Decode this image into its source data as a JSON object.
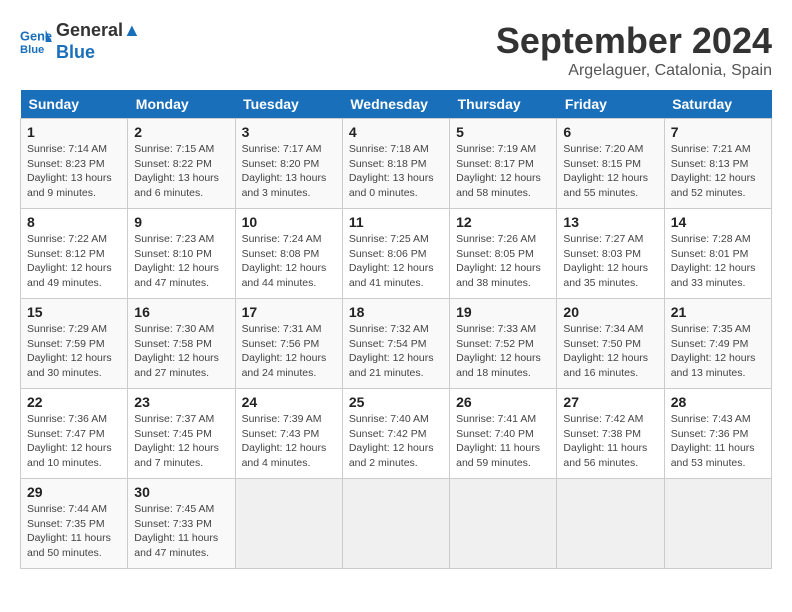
{
  "header": {
    "logo_line1": "General",
    "logo_line2": "Blue",
    "month": "September 2024",
    "location": "Argelaguer, Catalonia, Spain"
  },
  "weekdays": [
    "Sunday",
    "Monday",
    "Tuesday",
    "Wednesday",
    "Thursday",
    "Friday",
    "Saturday"
  ],
  "weeks": [
    [
      {
        "day": "1",
        "info": "Sunrise: 7:14 AM\nSunset: 8:23 PM\nDaylight: 13 hours\nand 9 minutes."
      },
      {
        "day": "2",
        "info": "Sunrise: 7:15 AM\nSunset: 8:22 PM\nDaylight: 13 hours\nand 6 minutes."
      },
      {
        "day": "3",
        "info": "Sunrise: 7:17 AM\nSunset: 8:20 PM\nDaylight: 13 hours\nand 3 minutes."
      },
      {
        "day": "4",
        "info": "Sunrise: 7:18 AM\nSunset: 8:18 PM\nDaylight: 13 hours\nand 0 minutes."
      },
      {
        "day": "5",
        "info": "Sunrise: 7:19 AM\nSunset: 8:17 PM\nDaylight: 12 hours\nand 58 minutes."
      },
      {
        "day": "6",
        "info": "Sunrise: 7:20 AM\nSunset: 8:15 PM\nDaylight: 12 hours\nand 55 minutes."
      },
      {
        "day": "7",
        "info": "Sunrise: 7:21 AM\nSunset: 8:13 PM\nDaylight: 12 hours\nand 52 minutes."
      }
    ],
    [
      {
        "day": "8",
        "info": "Sunrise: 7:22 AM\nSunset: 8:12 PM\nDaylight: 12 hours\nand 49 minutes."
      },
      {
        "day": "9",
        "info": "Sunrise: 7:23 AM\nSunset: 8:10 PM\nDaylight: 12 hours\nand 47 minutes."
      },
      {
        "day": "10",
        "info": "Sunrise: 7:24 AM\nSunset: 8:08 PM\nDaylight: 12 hours\nand 44 minutes."
      },
      {
        "day": "11",
        "info": "Sunrise: 7:25 AM\nSunset: 8:06 PM\nDaylight: 12 hours\nand 41 minutes."
      },
      {
        "day": "12",
        "info": "Sunrise: 7:26 AM\nSunset: 8:05 PM\nDaylight: 12 hours\nand 38 minutes."
      },
      {
        "day": "13",
        "info": "Sunrise: 7:27 AM\nSunset: 8:03 PM\nDaylight: 12 hours\nand 35 minutes."
      },
      {
        "day": "14",
        "info": "Sunrise: 7:28 AM\nSunset: 8:01 PM\nDaylight: 12 hours\nand 33 minutes."
      }
    ],
    [
      {
        "day": "15",
        "info": "Sunrise: 7:29 AM\nSunset: 7:59 PM\nDaylight: 12 hours\nand 30 minutes."
      },
      {
        "day": "16",
        "info": "Sunrise: 7:30 AM\nSunset: 7:58 PM\nDaylight: 12 hours\nand 27 minutes."
      },
      {
        "day": "17",
        "info": "Sunrise: 7:31 AM\nSunset: 7:56 PM\nDaylight: 12 hours\nand 24 minutes."
      },
      {
        "day": "18",
        "info": "Sunrise: 7:32 AM\nSunset: 7:54 PM\nDaylight: 12 hours\nand 21 minutes."
      },
      {
        "day": "19",
        "info": "Sunrise: 7:33 AM\nSunset: 7:52 PM\nDaylight: 12 hours\nand 18 minutes."
      },
      {
        "day": "20",
        "info": "Sunrise: 7:34 AM\nSunset: 7:50 PM\nDaylight: 12 hours\nand 16 minutes."
      },
      {
        "day": "21",
        "info": "Sunrise: 7:35 AM\nSunset: 7:49 PM\nDaylight: 12 hours\nand 13 minutes."
      }
    ],
    [
      {
        "day": "22",
        "info": "Sunrise: 7:36 AM\nSunset: 7:47 PM\nDaylight: 12 hours\nand 10 minutes."
      },
      {
        "day": "23",
        "info": "Sunrise: 7:37 AM\nSunset: 7:45 PM\nDaylight: 12 hours\nand 7 minutes."
      },
      {
        "day": "24",
        "info": "Sunrise: 7:39 AM\nSunset: 7:43 PM\nDaylight: 12 hours\nand 4 minutes."
      },
      {
        "day": "25",
        "info": "Sunrise: 7:40 AM\nSunset: 7:42 PM\nDaylight: 12 hours\nand 2 minutes."
      },
      {
        "day": "26",
        "info": "Sunrise: 7:41 AM\nSunset: 7:40 PM\nDaylight: 11 hours\nand 59 minutes."
      },
      {
        "day": "27",
        "info": "Sunrise: 7:42 AM\nSunset: 7:38 PM\nDaylight: 11 hours\nand 56 minutes."
      },
      {
        "day": "28",
        "info": "Sunrise: 7:43 AM\nSunset: 7:36 PM\nDaylight: 11 hours\nand 53 minutes."
      }
    ],
    [
      {
        "day": "29",
        "info": "Sunrise: 7:44 AM\nSunset: 7:35 PM\nDaylight: 11 hours\nand 50 minutes."
      },
      {
        "day": "30",
        "info": "Sunrise: 7:45 AM\nSunset: 7:33 PM\nDaylight: 11 hours\nand 47 minutes."
      },
      {
        "day": "",
        "info": ""
      },
      {
        "day": "",
        "info": ""
      },
      {
        "day": "",
        "info": ""
      },
      {
        "day": "",
        "info": ""
      },
      {
        "day": "",
        "info": ""
      }
    ]
  ]
}
